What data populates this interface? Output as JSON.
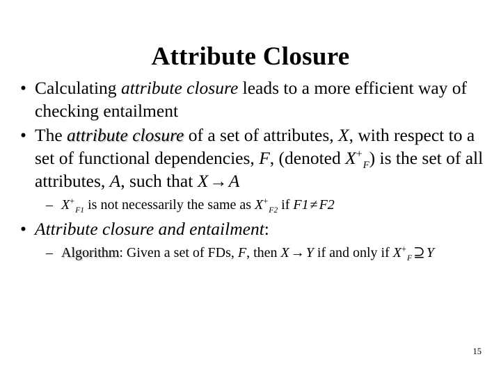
{
  "slide": {
    "title": "Attribute Closure",
    "page_number": "15",
    "background_color": "#ffffff",
    "text_color": "#000000",
    "shadow_color": "#c9c9c9",
    "bullet_glyph": "•",
    "dash_glyph": "–",
    "content": [
      {
        "level": 1,
        "id": "bullet-calculating",
        "runs": [
          {
            "text": "Calculating ",
            "style": "normal"
          },
          {
            "text": "attribute closure",
            "style": "italic"
          },
          {
            "text": " leads to a more efficient way of checking entailment",
            "style": "normal"
          }
        ],
        "plain": "Calculating attribute closure leads to a more efficient way of checking entailment"
      },
      {
        "level": 1,
        "id": "bullet-definition",
        "runs": [
          {
            "text": "The ",
            "style": "normal"
          },
          {
            "text": "attribute closure",
            "style": "italic-shadow"
          },
          {
            "text": " of a set of attributes, ",
            "style": "normal"
          },
          {
            "text": "X",
            "style": "italic"
          },
          {
            "text": ", with respect to a set of functional dependencies, ",
            "style": "normal"
          },
          {
            "text": "F",
            "style": "italic"
          },
          {
            "text": ",  (denoted ",
            "style": "normal"
          },
          {
            "text": "X",
            "style": "italic"
          },
          {
            "text": "+",
            "style": "superscript"
          },
          {
            "text": "F",
            "style": "subscript-italic"
          },
          {
            "text": ") is the set of all attributes, ",
            "style": "normal"
          },
          {
            "text": "A",
            "style": "italic"
          },
          {
            "text": ", such that ",
            "style": "normal"
          },
          {
            "text": "X",
            "style": "italic"
          },
          {
            "text": "→",
            "style": "symbol"
          },
          {
            "text": "A",
            "style": "italic"
          }
        ],
        "plain": "The attribute closure of a set of attributes, X, with respect to a set of functional dependencies, F, (denoted X+F) is the set of all attributes, A, such that X → A"
      },
      {
        "level": 2,
        "id": "subbullet-not-same",
        "runs": [
          {
            "text": "X",
            "style": "italic"
          },
          {
            "text": "+",
            "style": "superscript"
          },
          {
            "text": "F1",
            "style": "subscript-italic"
          },
          {
            "text": " is not necessarily the same as ",
            "style": "normal"
          },
          {
            "text": "X",
            "style": "italic"
          },
          {
            "text": "+",
            "style": "superscript"
          },
          {
            "text": "F2",
            "style": "subscript-italic"
          },
          {
            "text": "  if  ",
            "style": "normal"
          },
          {
            "text": "F1",
            "style": "italic"
          },
          {
            "text": "≠",
            "style": "symbol"
          },
          {
            "text": "F2",
            "style": "italic"
          }
        ],
        "plain": "X +F1 is not necessarily the same as X +F2 if F1 ≠ F2"
      },
      {
        "level": 1,
        "id": "bullet-closure-entailment",
        "runs": [
          {
            "text": "Attribute closure and entailment",
            "style": "italic"
          },
          {
            "text": ":",
            "style": "normal"
          }
        ],
        "plain": "Attribute closure and entailment:"
      },
      {
        "level": 2,
        "id": "subbullet-algorithm",
        "runs": [
          {
            "text": "Algorithm",
            "style": "shadow"
          },
          {
            "text": ": Given a set of FDs, ",
            "style": "normal"
          },
          {
            "text": "F",
            "style": "italic"
          },
          {
            "text": ", then ",
            "style": "normal"
          },
          {
            "text": "X",
            "style": "italic"
          },
          {
            "text": "→",
            "style": "symbol"
          },
          {
            "text": "Y",
            "style": "italic"
          },
          {
            "text": "  if and only if  ",
            "style": "normal"
          },
          {
            "text": "X",
            "style": "italic"
          },
          {
            "text": "+",
            "style": "superscript"
          },
          {
            "text": "F",
            "style": "subscript-italic"
          },
          {
            "text": "⊇",
            "style": "symbol"
          },
          {
            "text": "Y",
            "style": "italic"
          }
        ],
        "plain": "Algorithm: Given a set of FDs, F, then X → Y if and only if X+F ⊇ Y"
      }
    ],
    "text_fragments": {
      "b1_pre": "Calculating ",
      "b1_em": "attribute closure",
      "b1_post": " leads to a more efficient way of checking entailment",
      "b2_the": "The ",
      "b2_em": "attribute closure",
      "b2_of": " of a set of attributes, ",
      "b2_X": "X",
      "b2_comma_with": ", with respect to a set of functional dependencies, ",
      "b2_F": "F",
      "b2_denoted": ",  (denoted ",
      "b2_X2": "X",
      "b2_plus": "+",
      "b2_subF": "F",
      "b2_isset": ") is the set of all attributes, ",
      "b2_A": "A",
      "b2_suchthat": ", such that ",
      "b2_X3": "X",
      "b2_arrow": "→",
      "b2_A2": "A",
      "sb1_X": "X",
      "sb1_plus": "+",
      "sb1_subF1": "F1",
      "sb1_mid": " is not necessarily the same as ",
      "sb1_X2": "X",
      "sb1_plus2": "+",
      "sb1_subF2": "F2",
      "sb1_if": "  if  ",
      "sb1_F1": "F1",
      "sb1_neq": "≠",
      "sb1_F2": "F2",
      "b3_em": "Attribute closure and entailment",
      "b3_colon": ":",
      "sb2_algo": "Algorithm",
      "sb2_given": ": Given a set of FDs, ",
      "sb2_F": "F",
      "sb2_then": ", then ",
      "sb2_X": "X",
      "sb2_arrow": "→",
      "sb2_Y": "Y",
      "sb2_ifonly": "  if and only if  ",
      "sb2_X2": "X",
      "sb2_plus": "+",
      "sb2_subF": "F",
      "sb2_supseteq": "⊇",
      "sb2_Y2": "Y"
    }
  }
}
